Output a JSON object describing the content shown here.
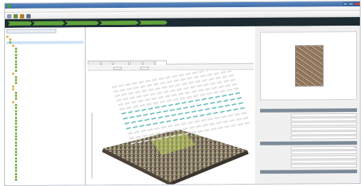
{
  "window": {
    "title": ""
  },
  "menu": {
    "items": [
      "",
      "",
      "",
      "",
      "",
      ""
    ]
  },
  "workflow": {
    "steps": [
      "",
      "",
      "",
      "",
      ""
    ],
    "status": "",
    "brand": ""
  },
  "left_panel": {
    "project_tab": "",
    "tree": [
      {
        "label": "",
        "kind": "folder",
        "depth": 0
      },
      {
        "label": "",
        "kind": "folder",
        "depth": 1
      },
      {
        "label": "",
        "kind": "item",
        "depth": 1
      },
      {
        "label": "",
        "kind": "folder",
        "depth": 2
      },
      {
        "label": "",
        "kind": "item",
        "depth": 3
      },
      {
        "label": "",
        "kind": "item",
        "depth": 3
      },
      {
        "label": "",
        "kind": "item",
        "depth": 3
      },
      {
        "label": "",
        "kind": "item",
        "depth": 3
      },
      {
        "label": "",
        "kind": "item",
        "depth": 3
      },
      {
        "label": "",
        "kind": "item",
        "depth": 3
      },
      {
        "label": "",
        "kind": "item",
        "depth": 3
      },
      {
        "label": "",
        "kind": "item",
        "depth": 3
      },
      {
        "label": "",
        "kind": "folder",
        "depth": 2
      },
      {
        "label": "",
        "kind": "item",
        "depth": 3
      },
      {
        "label": "",
        "kind": "item",
        "depth": 3
      },
      {
        "label": "",
        "kind": "item",
        "depth": 3
      },
      {
        "label": "",
        "kind": "folder",
        "depth": 2
      },
      {
        "label": "",
        "kind": "folder",
        "depth": 2
      },
      {
        "label": "",
        "kind": "item",
        "depth": 3
      },
      {
        "label": "",
        "kind": "item",
        "depth": 3
      },
      {
        "label": "",
        "kind": "item",
        "depth": 3
      },
      {
        "label": "",
        "kind": "folder",
        "depth": 2
      },
      {
        "label": "",
        "kind": "item",
        "depth": 3
      },
      {
        "label": "",
        "kind": "item",
        "depth": 3
      },
      {
        "label": "",
        "kind": "item",
        "depth": 3
      },
      {
        "label": "",
        "kind": "item",
        "depth": 3
      },
      {
        "label": "",
        "kind": "item",
        "depth": 3
      },
      {
        "label": "",
        "kind": "item",
        "depth": 3
      },
      {
        "label": "",
        "kind": "item",
        "depth": 3
      },
      {
        "label": "",
        "kind": "item",
        "depth": 3
      },
      {
        "label": "",
        "kind": "item",
        "depth": 3
      },
      {
        "label": "",
        "kind": "item",
        "depth": 3
      },
      {
        "label": "",
        "kind": "item",
        "depth": 3
      },
      {
        "label": "",
        "kind": "item",
        "depth": 3
      },
      {
        "label": "",
        "kind": "item",
        "depth": 3
      },
      {
        "label": "",
        "kind": "item",
        "depth": 3
      },
      {
        "label": "",
        "kind": "item",
        "depth": 3
      },
      {
        "label": "",
        "kind": "item",
        "depth": 3
      },
      {
        "label": "",
        "kind": "item",
        "depth": 3
      },
      {
        "label": "",
        "kind": "item",
        "depth": 3
      },
      {
        "label": "",
        "kind": "item",
        "depth": 3
      },
      {
        "label": "",
        "kind": "item",
        "depth": 3
      },
      {
        "label": "",
        "kind": "item",
        "depth": 3
      },
      {
        "label": "",
        "kind": "item",
        "depth": 3
      },
      {
        "label": "",
        "kind": "item",
        "depth": 3
      },
      {
        "label": "",
        "kind": "item",
        "depth": 3
      },
      {
        "label": "",
        "kind": "item",
        "depth": 3
      }
    ]
  },
  "center": {
    "block_title": "",
    "lines": [
      "",
      "",
      ""
    ],
    "tabs": [
      "",
      "",
      "",
      "",
      "",
      ""
    ],
    "active_tab": 5,
    "view_toolbar": {
      "show_label": "",
      "camera_label": ""
    }
  },
  "right_panel": {
    "preview_label": "",
    "preview_link": "",
    "sections": [
      {
        "title": "",
        "fields": [
          {
            "label": "",
            "value": ""
          },
          {
            "label": "",
            "value": ""
          },
          {
            "label": "",
            "value": ""
          },
          {
            "label": "",
            "value": ""
          },
          {
            "label": "",
            "value": ""
          },
          {
            "label": "",
            "value": ""
          }
        ]
      },
      {
        "title": "",
        "fields": [
          {
            "label": "",
            "value": "",
            "select": true
          },
          {
            "label": "",
            "value": ""
          },
          {
            "label": "",
            "value": ""
          },
          {
            "label": "",
            "value": ""
          },
          {
            "label": "",
            "value": ""
          }
        ]
      },
      {
        "title": "",
        "fields": []
      }
    ]
  },
  "colors": {
    "workflow_step": "#5fa43d",
    "workflow_bg": "#1d2b33",
    "brand_green": "#7cc24f",
    "camera_white": "#f2f2f2",
    "camera_cyan": "#5fd3d6",
    "selection_yellow": "#c8e25a"
  },
  "icons": [
    "app-icon",
    "new-project-icon",
    "open-icon",
    "save-icon",
    "settings-icon"
  ]
}
